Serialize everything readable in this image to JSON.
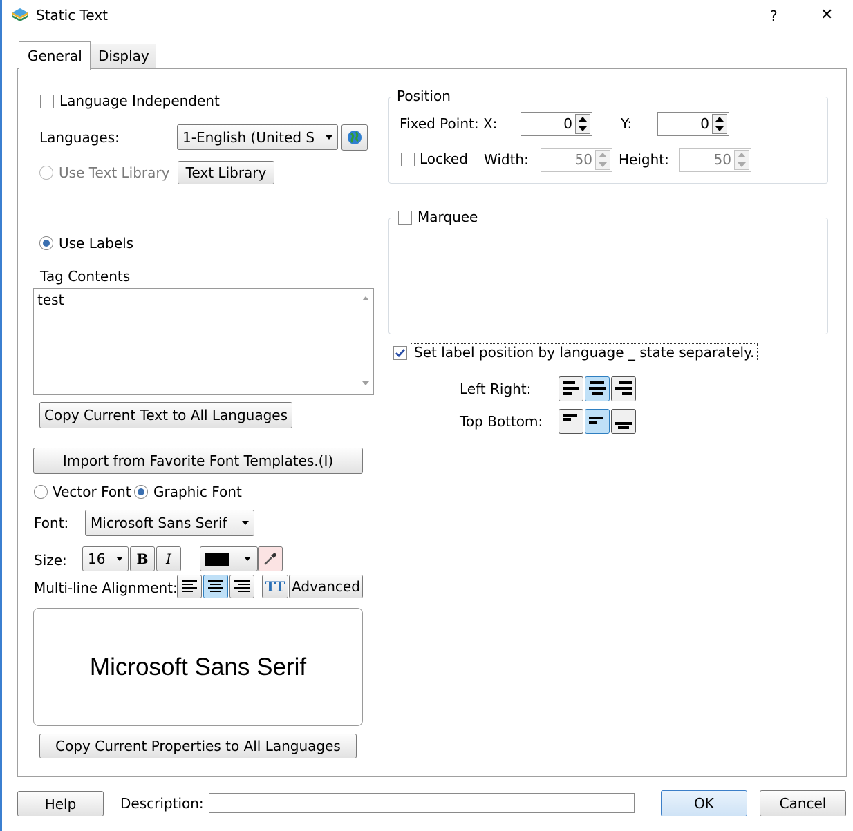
{
  "window": {
    "title": "Static Text",
    "help_glyph": "?",
    "close_glyph": "✕",
    "app_icon": "layers-icon"
  },
  "tabs": [
    {
      "label": "General",
      "active": true
    },
    {
      "label": "Display",
      "active": false
    }
  ],
  "left": {
    "language_independent": {
      "label": "Language Independent",
      "checked": false
    },
    "languages": {
      "label": "Languages:",
      "value": "1-English (United S",
      "globe_icon": "globe-icon"
    },
    "use_text_library": {
      "label": "Use Text Library",
      "enabled": false,
      "selected": false
    },
    "text_library_button": "Text Library",
    "use_labels": {
      "label": "Use Labels",
      "selected": true
    },
    "tag_contents": {
      "label": "Tag Contents",
      "value": "test"
    },
    "copy_text_button": "Copy Current Text to All Languages",
    "import_button": "Import from Favorite Font Templates.(I)",
    "vector_font": {
      "label": "Vector Font",
      "selected": false
    },
    "graphic_font": {
      "label": "Graphic Font",
      "selected": true
    },
    "font": {
      "label": "Font:",
      "value": "Microsoft Sans Serif"
    },
    "size": {
      "label": "Size:",
      "value": "16",
      "bold_glyph": "B",
      "italic_glyph": "I",
      "color": "#000000"
    },
    "multiline_alignment": {
      "label": "Multi-line Alignment:",
      "selected": "center",
      "tt_glyph": "TT",
      "advanced_button": "Advanced"
    },
    "preview_text": "Microsoft Sans Serif",
    "copy_props_button": "Copy Current Properties to All Languages"
  },
  "right": {
    "position": {
      "group_label": "Position",
      "fixed_point_label": "Fixed Point: X:",
      "x": "0",
      "y_label": "Y:",
      "y": "0",
      "locked": {
        "label": "Locked",
        "checked": false
      },
      "width_label": "Width:",
      "width": "50",
      "height_label": "Height:",
      "height": "50"
    },
    "marquee": {
      "label": "Marquee",
      "checked": false
    },
    "set_label_position": {
      "label": "Set label position by language _ state separately.",
      "checked": true
    },
    "left_right": {
      "label": "Left Right:",
      "selected": "center"
    },
    "top_bottom": {
      "label": "Top Bottom:",
      "selected": "center"
    }
  },
  "footer": {
    "help_button": "Help",
    "description_label": "Description:",
    "description_value": "",
    "ok_button": "OK",
    "cancel_button": "Cancel"
  },
  "colors": {
    "accent": "#3a6fb0",
    "selected_button": "#bfe0f7",
    "border": "#7a7a7a"
  }
}
